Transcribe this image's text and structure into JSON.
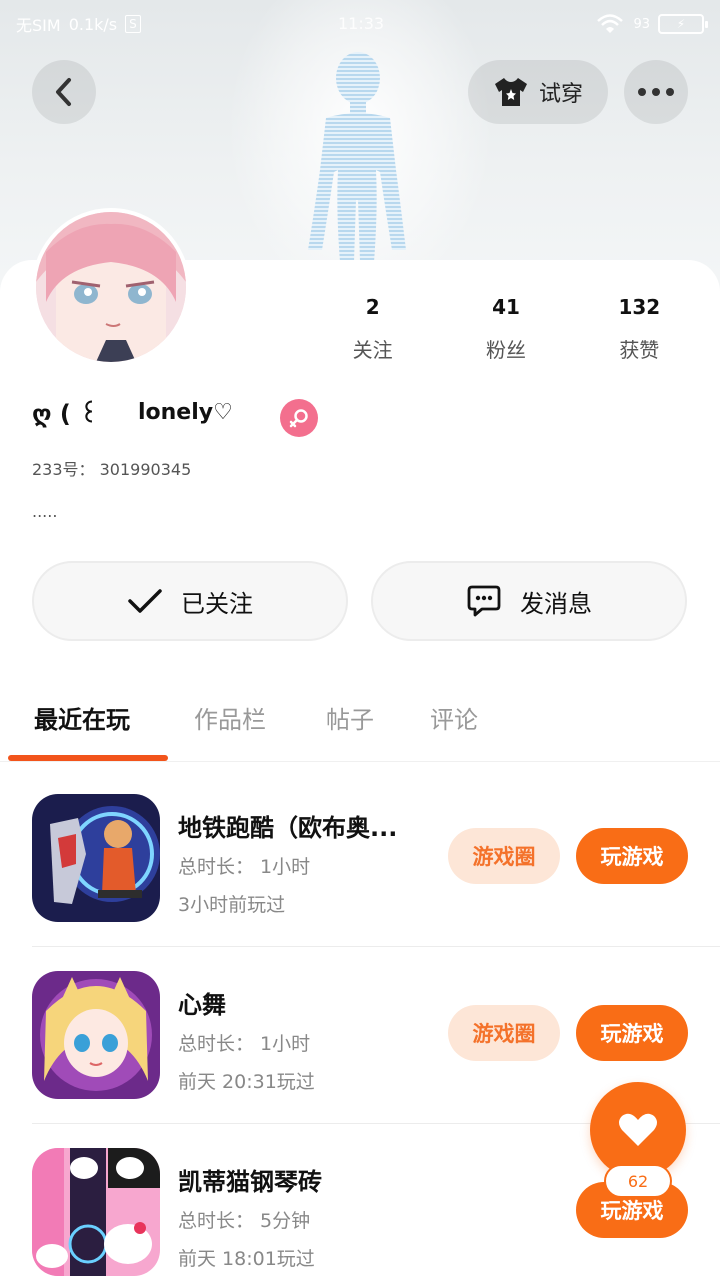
{
  "status_bar": {
    "carrier": "无SIM",
    "speed": "0.1k/s",
    "sim_icon_label": "S",
    "time": "11:33",
    "battery_text": "93"
  },
  "header": {
    "try_on_label": "试穿",
    "back_icon": "chevron-left-icon",
    "more_icon": "more-dots-icon",
    "try_on_icon": "tshirt-icon"
  },
  "profile": {
    "nickname_prefix": "ღ ( ꒰",
    "nickname": "lonely♡",
    "uid_text": "233号： 301990345",
    "bio": ".....",
    "gender_icon": "female-icon"
  },
  "stats": [
    {
      "value": "2",
      "label": "关注"
    },
    {
      "value": "41",
      "label": "粉丝"
    },
    {
      "value": "132",
      "label": "获赞"
    }
  ],
  "actions": {
    "follow_label": "已关注",
    "message_label": "发消息"
  },
  "tabs": [
    {
      "label": "最近在玩",
      "active": true
    },
    {
      "label": "作品栏",
      "active": false
    },
    {
      "label": "帖子",
      "active": false
    },
    {
      "label": "评论",
      "active": false
    }
  ],
  "games": [
    {
      "name": "地铁跑酷（欧布奥...",
      "duration": "总时长： 1小时",
      "last_played": "3小时前玩过",
      "circle_label": "游戏圈",
      "play_label": "玩游戏"
    },
    {
      "name": "心舞",
      "duration": "总时长： 1小时",
      "last_played": "前天 20:31玩过",
      "circle_label": "游戏圈",
      "play_label": "玩游戏"
    },
    {
      "name": "凯蒂猫钢琴砖",
      "duration": "总时长： 5分钟",
      "last_played": "前天 18:01玩过",
      "circle_label": "",
      "play_label": "玩游戏"
    }
  ],
  "like": {
    "count": "62",
    "icon": "heart-icon"
  },
  "colors": {
    "accent": "#f96d16",
    "accent_light": "#fde6d7",
    "tab_underline": "#f2541b",
    "gender_badge": "#f36f8e"
  }
}
